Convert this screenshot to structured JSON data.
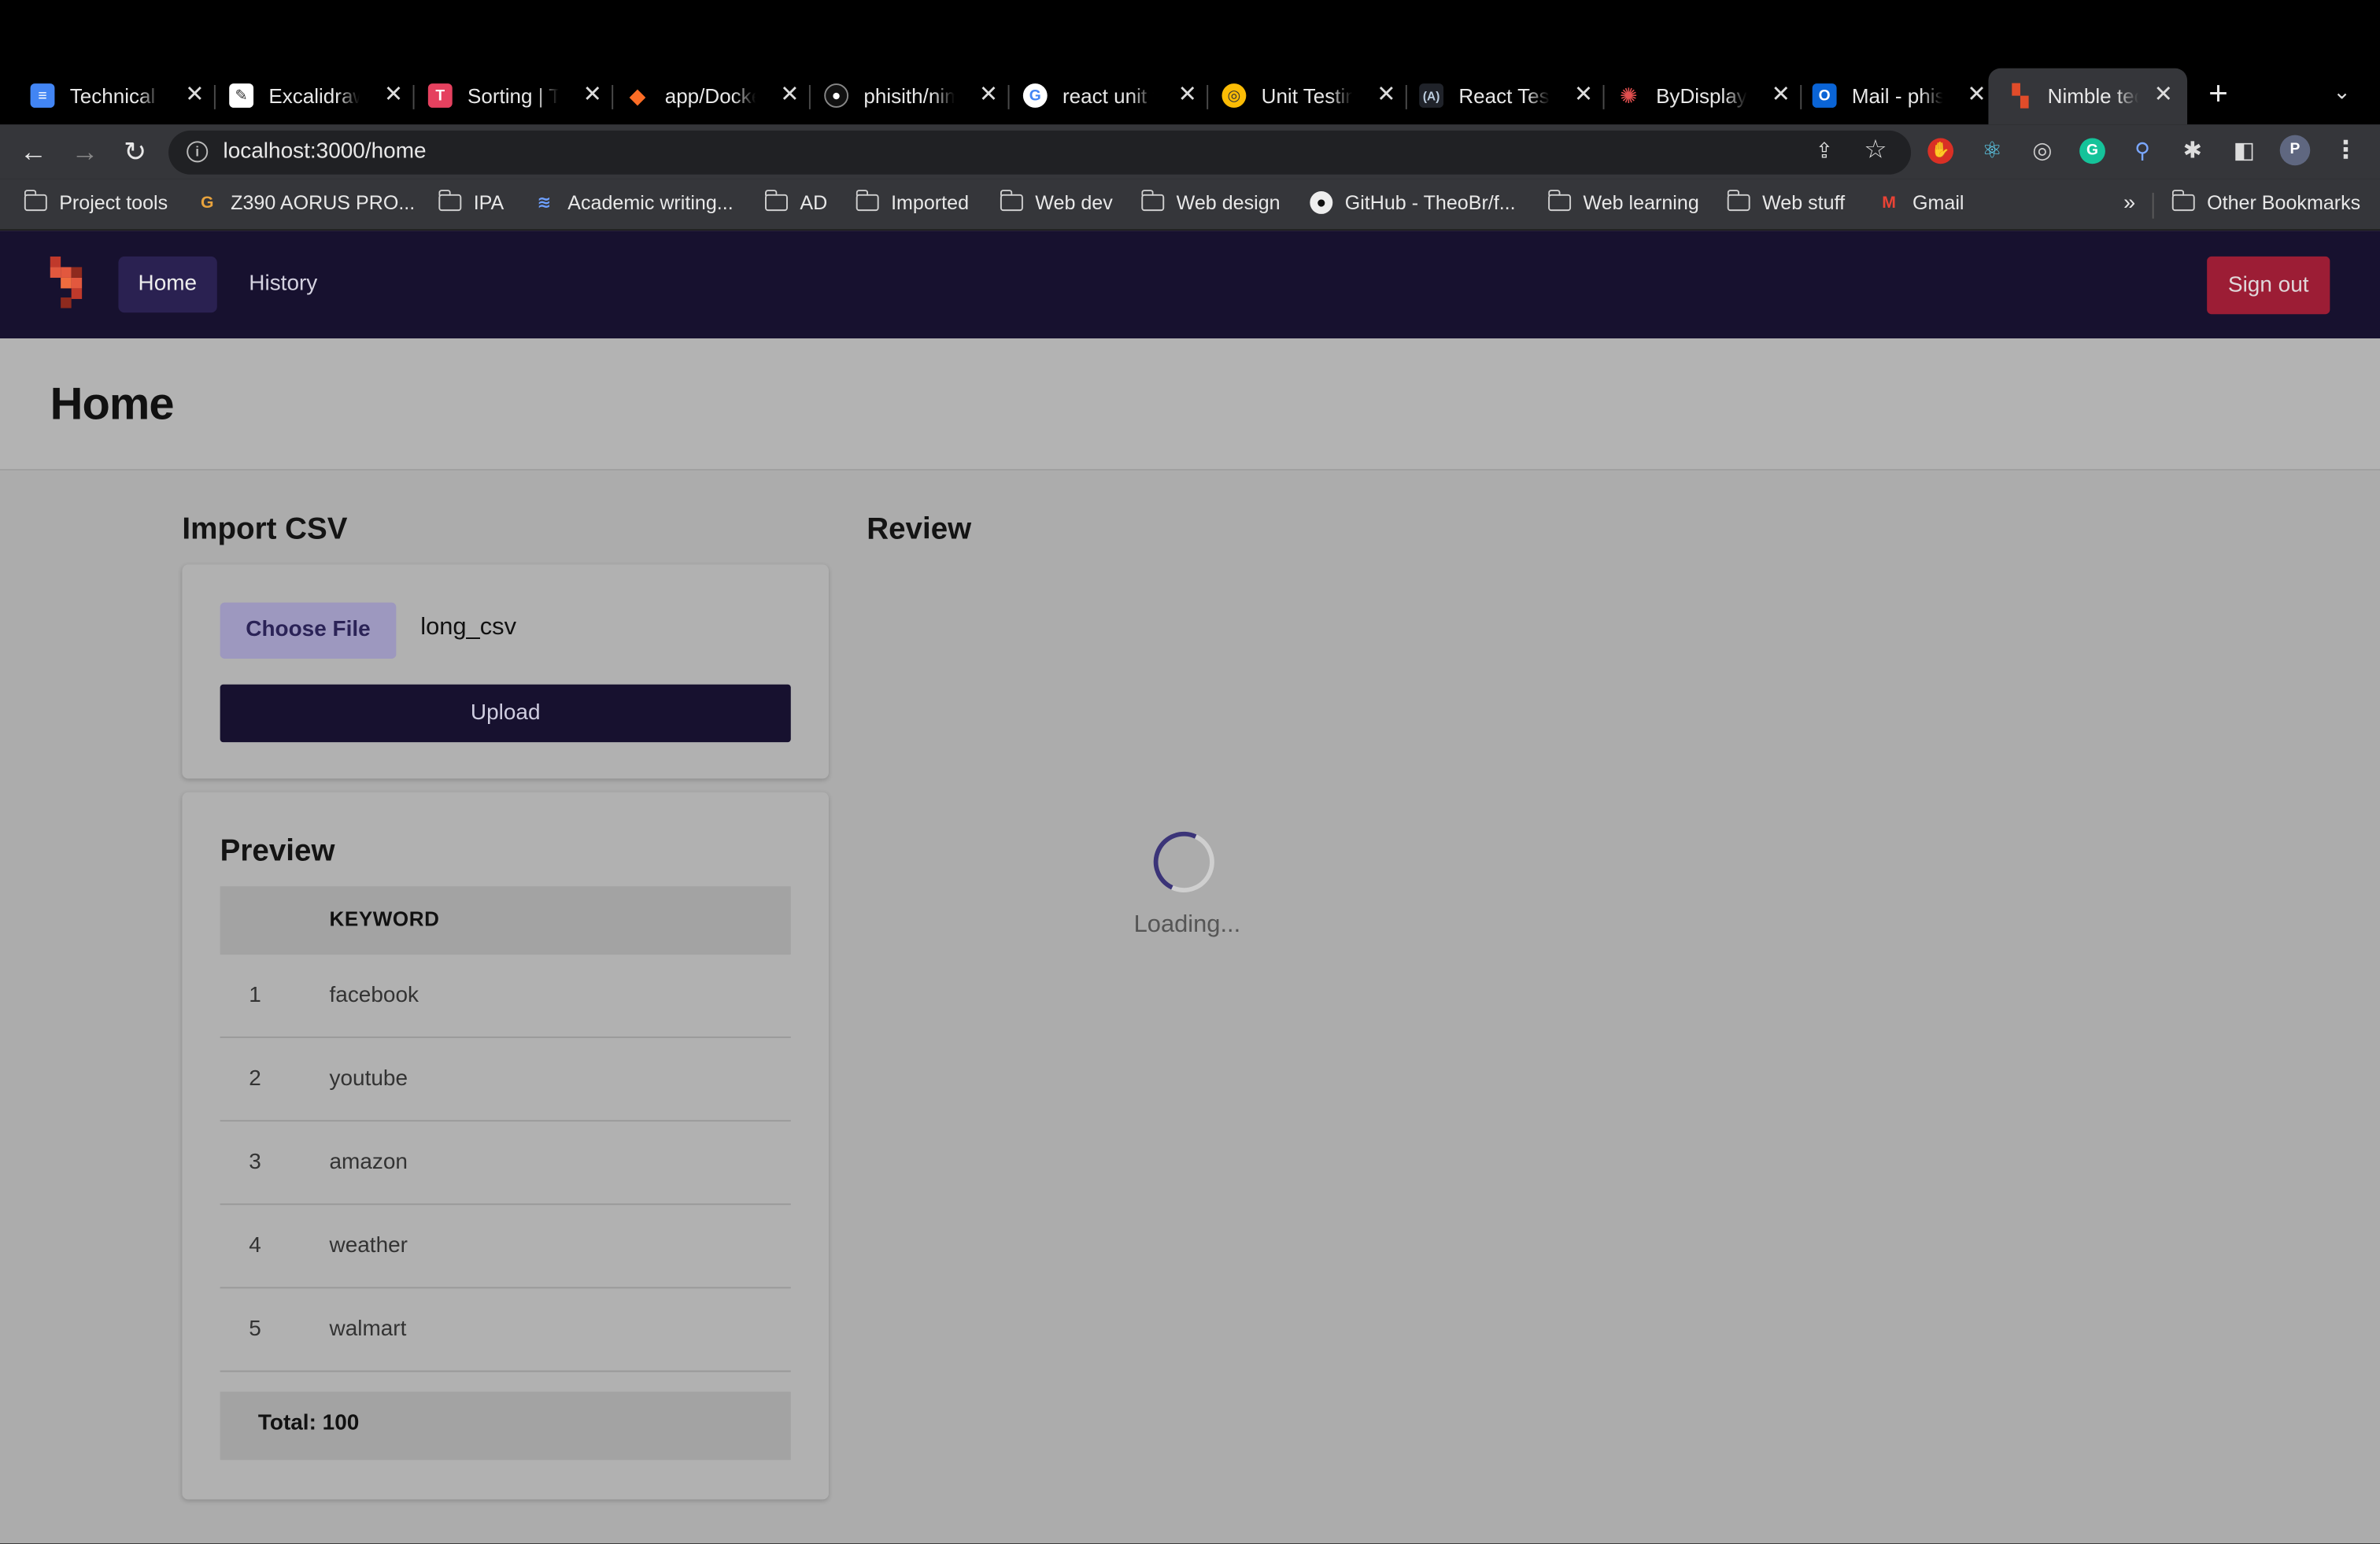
{
  "browser": {
    "tabs": [
      {
        "title": "Technical T",
        "icon": "google-docs-icon",
        "color": "#4285f4"
      },
      {
        "title": "Excalidraw",
        "icon": "excalidraw-icon",
        "color": "#ffffff"
      },
      {
        "title": "Sorting | Ta",
        "icon": "t-letter-icon",
        "color": "#e5415f"
      },
      {
        "title": "app/Docke",
        "icon": "gitlab-icon",
        "color": "#fc6d26"
      },
      {
        "title": "phisith/nim",
        "icon": "github-icon",
        "color": "#333333"
      },
      {
        "title": "react unit t",
        "icon": "google-icon",
        "color": "#ffffff"
      },
      {
        "title": "Unit Testin",
        "icon": "chrome-icon",
        "color": "#fbbc05"
      },
      {
        "title": "React Test",
        "icon": "react-testing-icon",
        "color": "#20232a"
      },
      {
        "title": "ByDisplayV",
        "icon": "octopus-icon",
        "color": "#e24f4f"
      },
      {
        "title": "Mail - phis",
        "icon": "outlook-icon",
        "color": "#0a64d6"
      },
      {
        "title": "Nimble tec",
        "icon": "nimble-icon",
        "color": "#e14c2a",
        "active": true
      }
    ],
    "url": "localhost:3000/home",
    "bookmarks": [
      {
        "label": "Project tools",
        "icon": "folder-icon"
      },
      {
        "label": "Z390 AORUS PRO...",
        "icon": "gigabyte-icon"
      },
      {
        "label": "IPA",
        "icon": "folder-icon"
      },
      {
        "label": "Academic writing...",
        "icon": "academic-icon"
      },
      {
        "label": "AD",
        "icon": "folder-icon"
      },
      {
        "label": "Imported",
        "icon": "folder-icon"
      },
      {
        "label": "Web dev",
        "icon": "folder-icon"
      },
      {
        "label": "Web design",
        "icon": "folder-icon"
      },
      {
        "label": "GitHub - TheoBr/f...",
        "icon": "github-icon"
      },
      {
        "label": "Web learning",
        "icon": "folder-icon"
      },
      {
        "label": "Web stuff",
        "icon": "folder-icon"
      },
      {
        "label": "Gmail",
        "icon": "gmail-icon"
      }
    ],
    "more_bookmarks": "»",
    "other_bookmarks": "Other Bookmarks",
    "profile_initial": "P"
  },
  "app": {
    "nav": {
      "home": "Home",
      "history": "History",
      "sign_out": "Sign out"
    },
    "page_title": "Home",
    "import": {
      "title": "Import CSV",
      "choose_file": "Choose File",
      "file_name": "long_csv",
      "upload": "Upload"
    },
    "preview": {
      "title": "Preview",
      "column": "KEYWORD",
      "rows": [
        {
          "index": "1",
          "keyword": "facebook"
        },
        {
          "index": "2",
          "keyword": "youtube"
        },
        {
          "index": "3",
          "keyword": "amazon"
        },
        {
          "index": "4",
          "keyword": "weather"
        },
        {
          "index": "5",
          "keyword": "walmart"
        }
      ],
      "total": "Total: 100"
    },
    "review": {
      "title": "Review",
      "loading": "Loading..."
    }
  },
  "colors": {
    "nav": "#17112f",
    "sign_out": "#9c1d35",
    "accent": "#9d98bf"
  }
}
